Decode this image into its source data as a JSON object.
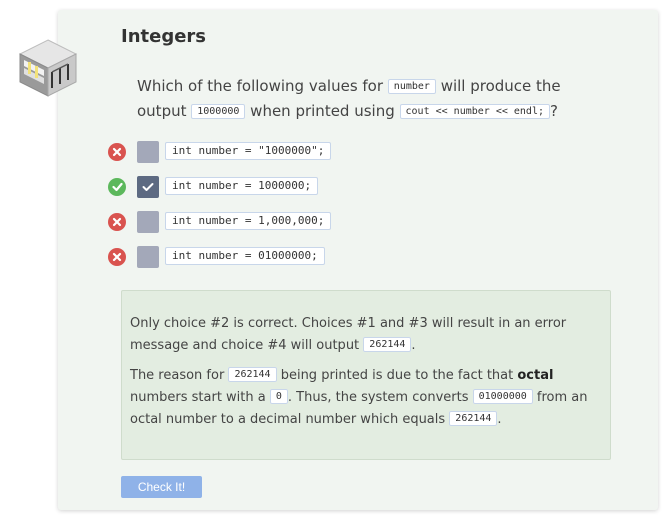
{
  "title": "Integers",
  "question": {
    "text_before": "Which of the following values for ",
    "code_var": "number",
    "text_mid": " will produce the output ",
    "code_value": "1000000",
    "text_mid2": " when printed using ",
    "code_stmt": "cout << number << endl;",
    "text_after": "?"
  },
  "choices": [
    {
      "code": "int number = \"1000000\";",
      "status": "wrong",
      "checked": false
    },
    {
      "code": "int number = 1000000;",
      "status": "correct",
      "checked": true
    },
    {
      "code": "int number = 1,000,000;",
      "status": "wrong",
      "checked": false
    },
    {
      "code": "int number = 01000000;",
      "status": "wrong",
      "checked": false
    }
  ],
  "explanation": {
    "p1_text": "Only choice #2 is correct. Choices #1 and #3 will result in an error message and choice #4 will output ",
    "p1_code": "262144",
    "p1_end": ".",
    "p2_a": "The reason for ",
    "p2_code1": "262144",
    "p2_b": " being printed is due to the fact that ",
    "p2_bold": "octal",
    "p2_c": " numbers start with a ",
    "p2_code2": "0",
    "p2_d": ". Thus, the system converts ",
    "p2_code3": "01000000",
    "p2_e": " from an octal number to a decimal number which equals ",
    "p2_code4": "262144",
    "p2_f": "."
  },
  "check_button_label": "Check It!",
  "colors": {
    "wrong": "#d9534f",
    "correct": "#5cb85c",
    "checkbox": "#a3a8b9",
    "checkbox_checked": "#5d6a82",
    "button": "#8fb2e8",
    "explanation_bg": "#e3ede1"
  },
  "icons": {
    "wrong": "x-circle-icon",
    "correct": "check-circle-icon",
    "lesson": "server-rack-cube-icon"
  }
}
